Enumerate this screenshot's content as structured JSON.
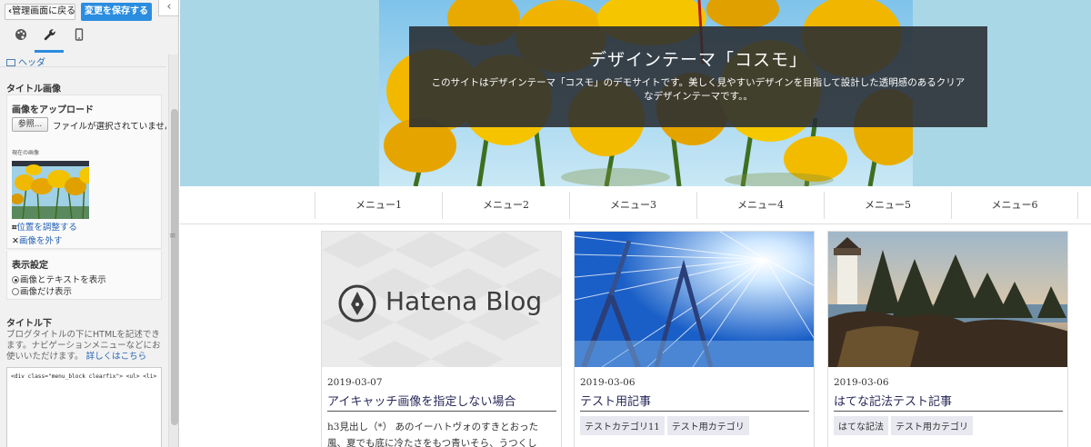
{
  "toolbar": {
    "back_label": "管理画面に戻る",
    "save_label": "変更を保存する",
    "collapse_icon": "chevron-left-icon",
    "tabs": [
      "palette-icon",
      "wrench-icon",
      "mobile-icon"
    ]
  },
  "panel": {
    "section_header": "ヘッダ",
    "title_image_heading": "タイトル画像",
    "upload_label": "画像をアップロード",
    "browse_button": "参照...",
    "no_file_text": "ファイルが選択されていません。",
    "current_image_label": "現在の画像",
    "adjust_link": "位置を調整する",
    "remove_link": "画像を外す",
    "display_heading": "表示設定",
    "display_options": [
      "画像とテキストを表示",
      "画像だけ表示"
    ],
    "below_title_heading": "タイトル下",
    "below_title_desc": "ブログタイトルの下にHTMLを記述できます。ナビゲーションメニューなどにお使いいただけます。",
    "details_link": "詳しくはこちら",
    "code_value": "<div class=\"menu_block clearfix\"> <ul> <li>"
  },
  "preview": {
    "site_title": "デザインテーマ「コスモ」",
    "site_description": "このサイトはデザインテーマ「コスモ」のデモサイトです。美しく見やすいデザインを目指して設計した透明感のあるクリアなデザインテーマです。。",
    "menu": [
      "メニュー1",
      "メニュー2",
      "メニュー3",
      "メニュー4",
      "メニュー5",
      "メニュー6"
    ],
    "cards": [
      {
        "image": "hatena-blog-placeholder",
        "logo_text": "Hatena Blog",
        "date": "2019-03-07",
        "title": "アイキャッチ画像を指定しない場合",
        "excerpt": "h3見出し（*） あのイーハトヴォのすきとおった風、夏でも底に冷たさをもつ青いそら、うつくし"
      },
      {
        "image": "bridge-photo",
        "date": "2019-03-06",
        "title": "テスト用記事",
        "tags": [
          "テストカテゴリ11",
          "テスト用カテゴリ"
        ]
      },
      {
        "image": "lighthouse-photo",
        "date": "2019-03-06",
        "title": "はてな記法テスト記事",
        "tags": [
          "はてな記法",
          "テスト用カテゴリ"
        ]
      }
    ]
  }
}
